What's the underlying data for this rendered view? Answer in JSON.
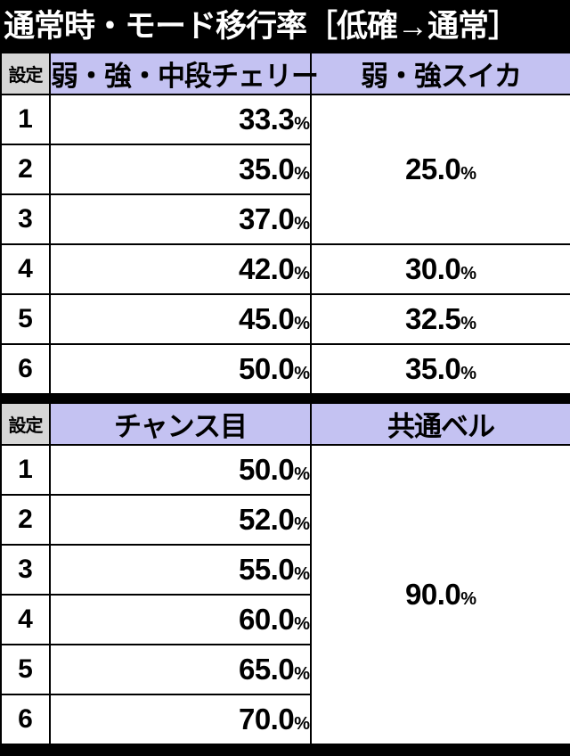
{
  "title": "通常時・モード移行率［低確→通常］",
  "tables": [
    {
      "headers": {
        "setting": "設定",
        "col1": "弱・強・中段チェリー",
        "col2": "弱・強スイカ"
      },
      "percent_symbol": "%",
      "rows": [
        {
          "setting": "1",
          "col1": "33.3"
        },
        {
          "setting": "2",
          "col1": "35.0"
        },
        {
          "setting": "3",
          "col1": "37.0"
        },
        {
          "setting": "4",
          "col1": "42.0",
          "col2": "30.0"
        },
        {
          "setting": "5",
          "col1": "45.0",
          "col2": "32.5"
        },
        {
          "setting": "6",
          "col1": "50.0",
          "col2": "35.0"
        }
      ],
      "merged_col2_rows_1_3": "25.0"
    },
    {
      "headers": {
        "setting": "設定",
        "col1": "チャンス目",
        "col2": "共通ベル"
      },
      "percent_symbol": "%",
      "rows": [
        {
          "setting": "1",
          "col1": "50.0"
        },
        {
          "setting": "2",
          "col1": "52.0"
        },
        {
          "setting": "3",
          "col1": "55.0"
        },
        {
          "setting": "4",
          "col1": "60.0"
        },
        {
          "setting": "5",
          "col1": "65.0"
        },
        {
          "setting": "6",
          "col1": "70.0"
        }
      ],
      "merged_col2_all_rows": "90.0"
    }
  ],
  "colors": {
    "title_bg": "#000000",
    "title_fg": "#ffffff",
    "header_lavender": "#c4c2f2",
    "header_gray": "#d6d6d6",
    "cell_bg": "#ffffff",
    "border": "#000000"
  }
}
